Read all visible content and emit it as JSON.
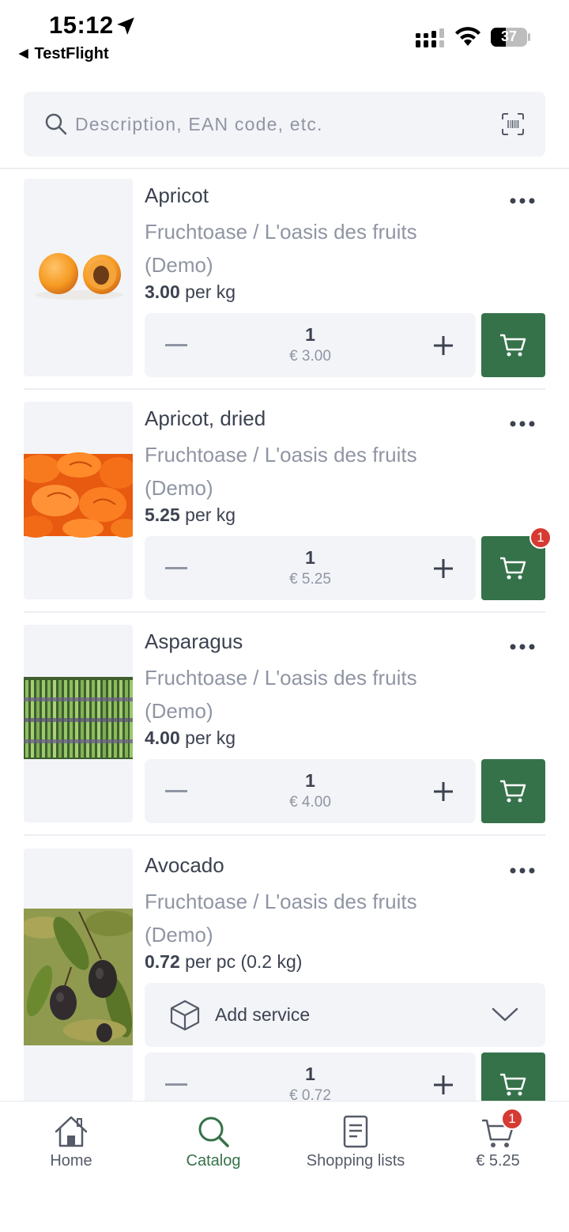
{
  "status_bar": {
    "time": "15:12",
    "back_app": "TestFlight",
    "battery": "37"
  },
  "search": {
    "placeholder": "Description, EAN code, etc."
  },
  "products": [
    {
      "name": "Apricot",
      "supplier": "Fruchtoase / L'oasis des fruits (Demo)",
      "price": "3.00",
      "unit": "per kg",
      "quantity": "1",
      "total": "€ 3.00",
      "image": "apricot-photo"
    },
    {
      "name": "Apricot, dried",
      "supplier": "Fruchtoase / L'oasis des fruits (Demo)",
      "price": "5.25",
      "unit": "per kg",
      "quantity": "1",
      "total": "€ 5.25",
      "cart_badge": "1",
      "image": "dried-apricot-photo"
    },
    {
      "name": "Asparagus",
      "supplier": "Fruchtoase / L'oasis des fruits (Demo)",
      "price": "4.00",
      "unit": "per kg",
      "quantity": "1",
      "total": "€ 4.00",
      "image": "asparagus-photo"
    },
    {
      "name": "Avocado",
      "supplier": "Fruchtoase / L'oasis des fruits (Demo)",
      "price": "0.72",
      "unit": "per pc (0.2 kg)",
      "service_label": "Add service",
      "quantity": "1",
      "total": "€ 0.72",
      "image": "avocado-photo"
    }
  ],
  "bottom_nav": {
    "items": [
      {
        "label": "Home",
        "icon": "home-icon"
      },
      {
        "label": "Catalog",
        "icon": "search-icon",
        "active": true
      },
      {
        "label": "Shopping lists",
        "icon": "list-icon"
      },
      {
        "label": "€ 5.25",
        "icon": "cart-icon",
        "badge": "1"
      }
    ]
  },
  "colors": {
    "accent": "#35724a",
    "badge": "#d63a32",
    "muted_text": "#8f95a3",
    "card_bg": "#f3f4f8"
  }
}
